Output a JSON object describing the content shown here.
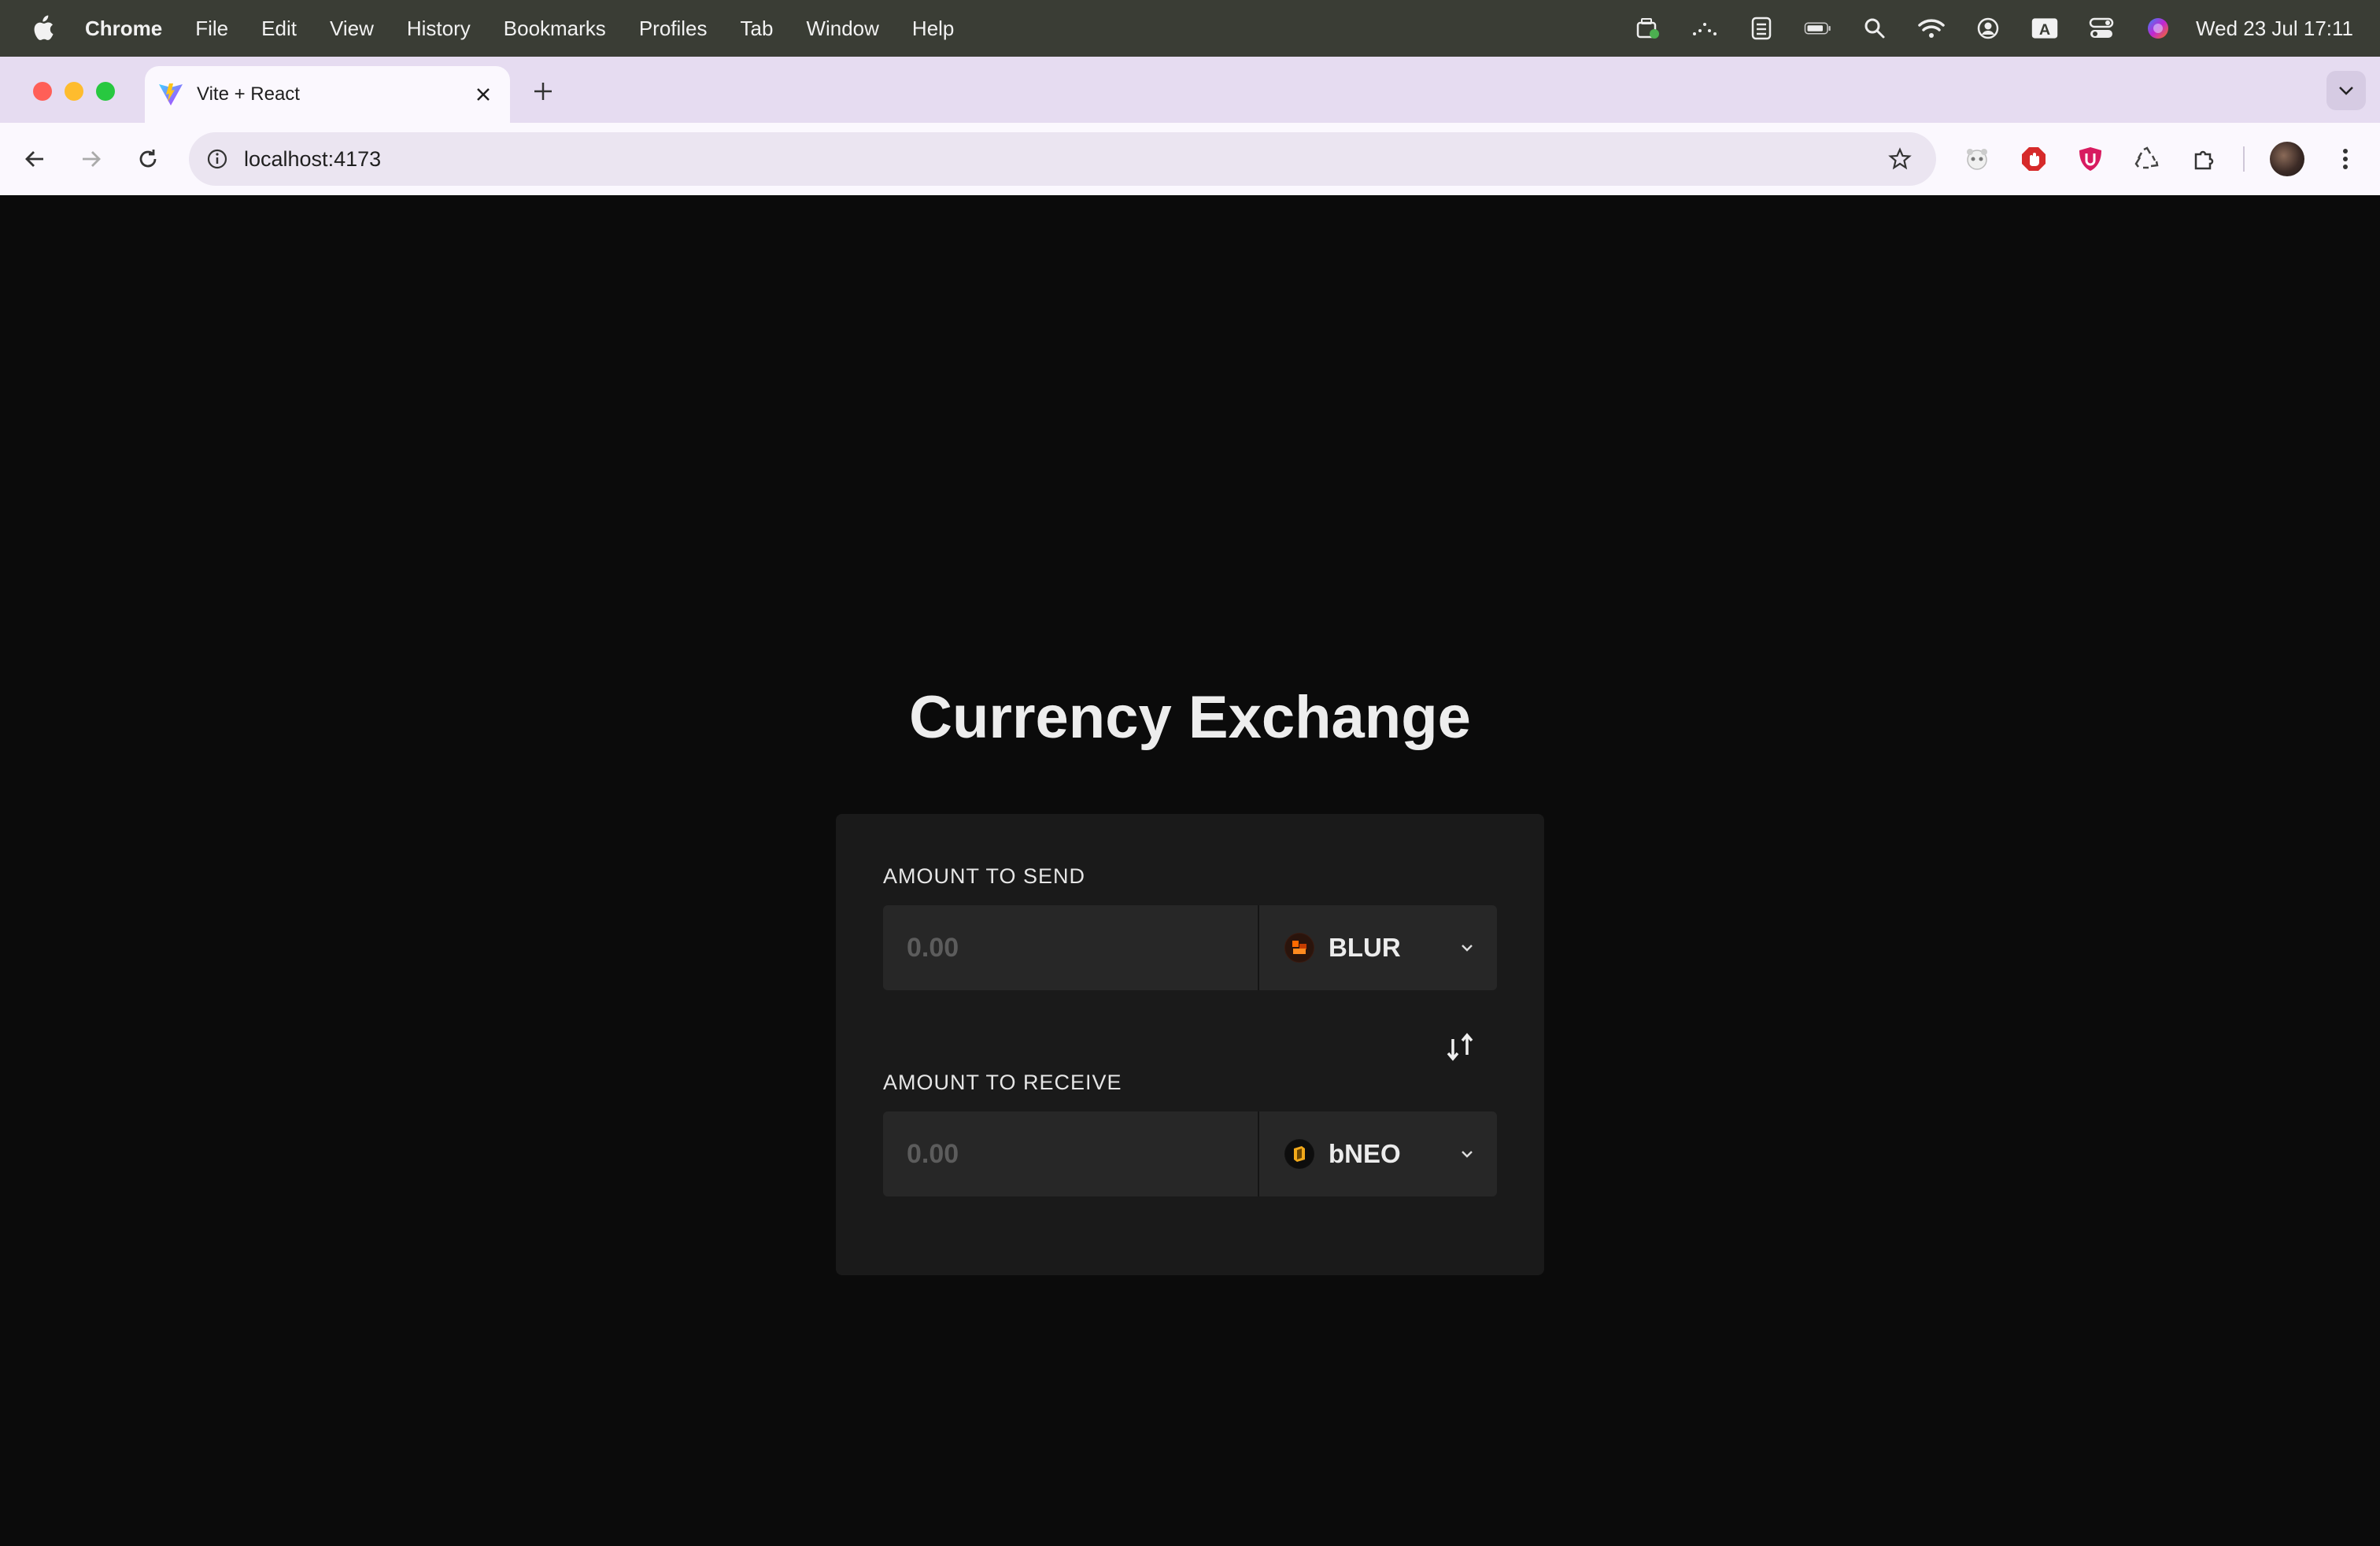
{
  "menubar": {
    "app_name": "Chrome",
    "menus": [
      "File",
      "Edit",
      "View",
      "History",
      "Bookmarks",
      "Profiles",
      "Tab",
      "Window",
      "Help"
    ],
    "clock": "Wed 23 Jul  17:11",
    "keyboard_indicator": "A"
  },
  "browser": {
    "tab_title": "Vite + React",
    "url": "localhost:4173"
  },
  "exchange": {
    "title": "Currency Exchange",
    "send_label": "AMOUNT TO SEND",
    "send_placeholder": "0.00",
    "send_currency": "BLUR",
    "receive_label": "AMOUNT TO RECEIVE",
    "receive_placeholder": "0.00",
    "receive_currency": "bNEO"
  },
  "colors": {
    "page_background": "#0b0b0b",
    "card_background": "#1a1a1a",
    "input_background": "#272727",
    "tab_strip": "#e6dcf1"
  }
}
